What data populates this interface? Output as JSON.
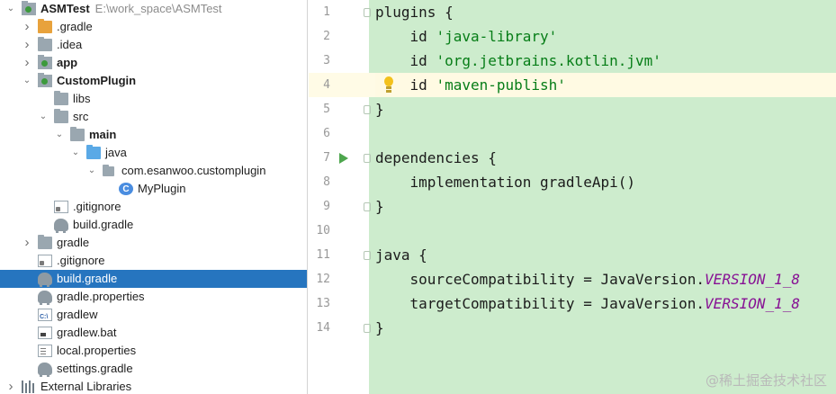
{
  "project_tree": {
    "rows": [
      {
        "label": "ASMTest",
        "path": "E:\\work_space\\ASMTest",
        "icon": "module-icon",
        "arrow": "expanded",
        "bold": true
      },
      {
        "label": ".gradle",
        "icon": "folder-orange-icon",
        "arrow": "collapsed"
      },
      {
        "label": ".idea",
        "icon": "folder-icon",
        "arrow": "collapsed"
      },
      {
        "label": "app",
        "icon": "module-icon",
        "arrow": "collapsed",
        "bold": true
      },
      {
        "label": "CustomPlugin",
        "icon": "module-icon",
        "arrow": "expanded",
        "bold": true
      },
      {
        "label": "libs",
        "icon": "folder-icon"
      },
      {
        "label": "src",
        "icon": "folder-icon",
        "arrow": "expanded"
      },
      {
        "label": "main",
        "icon": "folder-icon",
        "arrow": "expanded",
        "bold": true
      },
      {
        "label": "java",
        "icon": "folder-blue-icon",
        "arrow": "expanded"
      },
      {
        "label": "com.esanwoo.customplugin",
        "icon": "package-icon",
        "arrow": "expanded"
      },
      {
        "label": "MyPlugin",
        "icon": "kotlin-class-icon"
      },
      {
        "label": ".gitignore",
        "icon": "gitignore-file-icon"
      },
      {
        "label": "build.gradle",
        "icon": "gradle-elephant-icon"
      },
      {
        "label": "gradle",
        "icon": "folder-icon",
        "arrow": "collapsed"
      },
      {
        "label": ".gitignore",
        "icon": "gitignore-file-icon"
      },
      {
        "label": "build.gradle",
        "icon": "gradle-elephant-icon",
        "selected": true
      },
      {
        "label": "gradle.properties",
        "icon": "gradle-elephant-icon"
      },
      {
        "label": "gradlew",
        "icon": "shell-file-icon"
      },
      {
        "label": "gradlew.bat",
        "icon": "bat-file-icon"
      },
      {
        "label": "local.properties",
        "icon": "properties-file-icon"
      },
      {
        "label": "settings.gradle",
        "icon": "gradle-elephant-icon"
      },
      {
        "label": "External Libraries",
        "icon": "libraries-icon",
        "arrow": "collapsed"
      }
    ]
  },
  "editor": {
    "current_line": 4,
    "lines": [
      {
        "num": "1",
        "tokens": [
          {
            "t": "plugins {",
            "k": "plain"
          }
        ]
      },
      {
        "num": "2",
        "tokens": [
          {
            "t": "    id ",
            "k": "plain"
          },
          {
            "t": "'java-library'",
            "k": "str"
          }
        ]
      },
      {
        "num": "3",
        "tokens": [
          {
            "t": "    id ",
            "k": "plain"
          },
          {
            "t": "'org.jetbrains.kotlin.jvm'",
            "k": "str"
          }
        ]
      },
      {
        "num": "4",
        "tokens": [
          {
            "t": "    id ",
            "k": "plain"
          },
          {
            "t": "'maven-publish'",
            "k": "str"
          }
        ]
      },
      {
        "num": "5",
        "tokens": [
          {
            "t": "}",
            "k": "plain"
          }
        ]
      },
      {
        "num": "6",
        "tokens": []
      },
      {
        "num": "7",
        "tokens": [
          {
            "t": "dependencies {",
            "k": "plain"
          }
        ]
      },
      {
        "num": "8",
        "tokens": [
          {
            "t": "    implementation gradleApi()",
            "k": "plain"
          }
        ]
      },
      {
        "num": "9",
        "tokens": [
          {
            "t": "}",
            "k": "plain"
          }
        ]
      },
      {
        "num": "10",
        "tokens": []
      },
      {
        "num": "11",
        "tokens": [
          {
            "t": "java {",
            "k": "plain"
          }
        ]
      },
      {
        "num": "12",
        "tokens": [
          {
            "t": "    sourceCompatibility = JavaVersion.",
            "k": "plain"
          },
          {
            "t": "VERSION_1_8",
            "k": "const"
          }
        ]
      },
      {
        "num": "13",
        "tokens": [
          {
            "t": "    targetCompatibility = JavaVersion.",
            "k": "plain"
          },
          {
            "t": "VERSION_1_8",
            "k": "const"
          }
        ]
      },
      {
        "num": "14",
        "tokens": [
          {
            "t": "}",
            "k": "plain"
          }
        ]
      }
    ],
    "run_gutter_line": 7,
    "intention_bulb_line": 4,
    "fold_markers": [
      1,
      5,
      7,
      9,
      11,
      14
    ]
  },
  "watermark": "@稀土掘金技术社区",
  "colors": {
    "selection": "#2675bf",
    "editor_bg": "#cdeccd",
    "string": "#067d17",
    "constant": "#871094"
  }
}
